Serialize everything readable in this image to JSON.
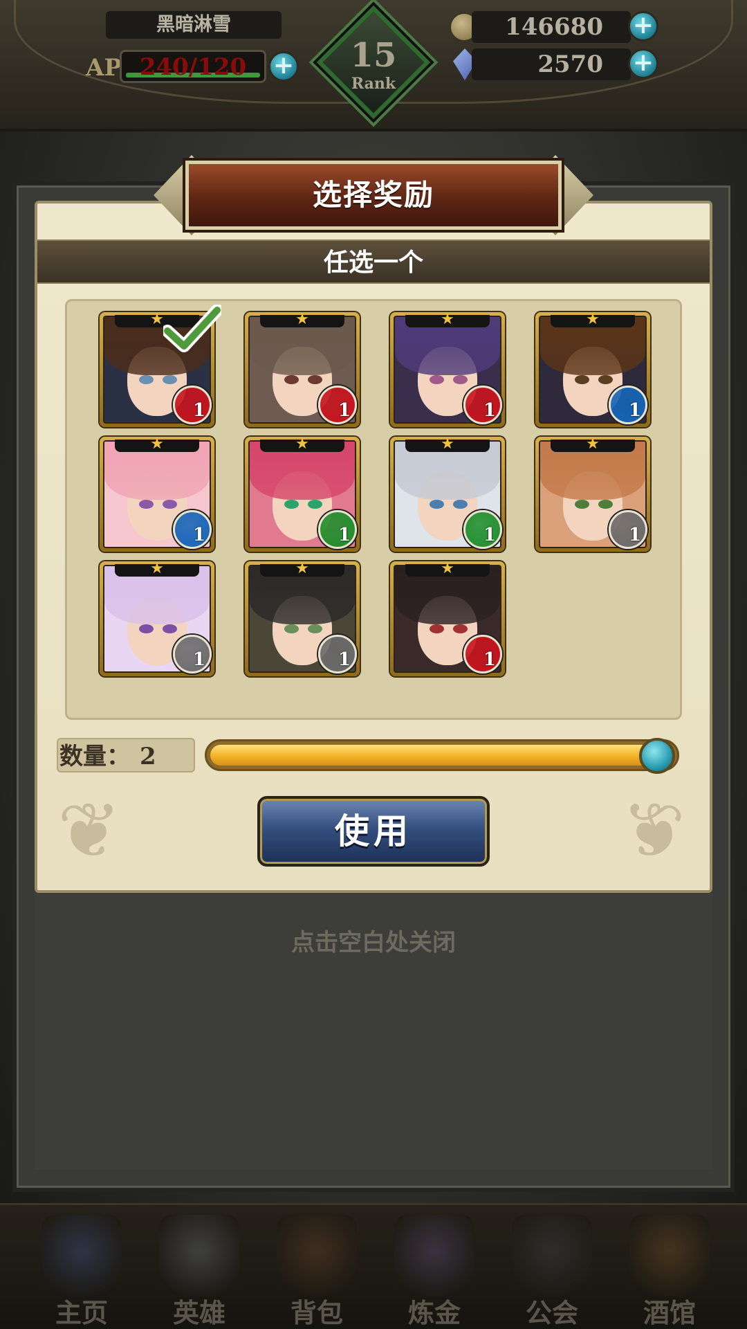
{
  "hud": {
    "player_name": "黑暗淋雪",
    "ap_label": "AP",
    "ap_value": "240/120",
    "ap_fill": 1.0,
    "rank_number": "15",
    "rank_label": "Rank",
    "gold": "146680",
    "crystals": "2570",
    "plus_symbol": "+"
  },
  "dialog": {
    "title": "选择奖励",
    "subtitle": "任选一个",
    "quantity_label": "数量：",
    "quantity_value": "2",
    "slider_fill": 1.0,
    "use_button": "使用",
    "close_hint": "点击空白处关闭"
  },
  "heroes": [
    {
      "name": "hero-1",
      "stars": "★",
      "level": "1",
      "class_color": "#c8141e",
      "class_icon": "sword-class-icon",
      "hair": "#4a2c1a",
      "bg": "#2b3145",
      "eye": "#6b8fb3",
      "selected": true
    },
    {
      "name": "hero-2",
      "stars": "★",
      "level": "1",
      "class_color": "#c8141e",
      "class_icon": "sword-class-icon",
      "hair": "#6b5a4c",
      "bg": "#6e5b52",
      "eye": "#6b3a33",
      "selected": false
    },
    {
      "name": "hero-3",
      "stars": "★",
      "level": "1",
      "class_color": "#c8141e",
      "class_icon": "scythe-class-icon",
      "hair": "#4f3b7a",
      "bg": "#3a2e4d",
      "eye": "#a3588a",
      "selected": false
    },
    {
      "name": "hero-4",
      "stars": "★",
      "level": "1",
      "class_color": "#1565b8",
      "class_icon": "spear-class-icon",
      "hair": "#5b3417",
      "bg": "#2e2a3c",
      "eye": "#5a4020",
      "selected": false
    },
    {
      "name": "hero-5",
      "stars": "★",
      "level": "1",
      "class_color": "#1565b8",
      "class_icon": "staff-class-icon",
      "hair": "#f0a4b4",
      "bg": "#f6c7cf",
      "eye": "#8a5aa8",
      "selected": false
    },
    {
      "name": "hero-6",
      "stars": "★",
      "level": "1",
      "class_color": "#1f8f2c",
      "class_icon": "leaf-class-icon",
      "hair": "#d6466a",
      "bg": "#e27a8f",
      "eye": "#2da36b",
      "selected": false
    },
    {
      "name": "hero-7",
      "stars": "★",
      "level": "1",
      "class_color": "#1f8f2c",
      "class_icon": "leaf-class-icon",
      "hair": "#c5cad4",
      "bg": "#dfe3ea",
      "eye": "#4a7fb0",
      "selected": false
    },
    {
      "name": "hero-8",
      "stars": "★",
      "level": "1",
      "class_color": "#6b6b6b",
      "class_icon": "bow-class-icon",
      "hair": "#c47a4a",
      "bg": "#d9a07a",
      "eye": "#4d7f3a",
      "selected": false
    },
    {
      "name": "hero-9",
      "stars": "★",
      "level": "1",
      "class_color": "#6b6b6b",
      "class_icon": "wand-class-icon",
      "hair": "#d9c1ea",
      "bg": "#e8d6f2",
      "eye": "#7c4ea8",
      "selected": false
    },
    {
      "name": "hero-10",
      "stars": "★",
      "level": "1",
      "class_color": "#6b6b6b",
      "class_icon": "wand-class-icon",
      "hair": "#2c2a28",
      "bg": "#4a4638",
      "eye": "#6a8f5a",
      "selected": false
    },
    {
      "name": "hero-11",
      "stars": "★",
      "level": "1",
      "class_color": "#c8141e",
      "class_icon": "scythe-class-icon",
      "hair": "#2b2020",
      "bg": "#3a2a2a",
      "eye": "#a13030",
      "selected": false
    }
  ],
  "nav": [
    {
      "label": "主页",
      "color": "#5a6ea8",
      "icon": "castle-icon"
    },
    {
      "label": "英雄",
      "color": "#8a8f98",
      "icon": "helmet-icon"
    },
    {
      "label": "背包",
      "color": "#8a5a3a",
      "icon": "bag-icon"
    },
    {
      "label": "炼金",
      "color": "#7a6a9a",
      "icon": "potion-icon"
    },
    {
      "label": "公会",
      "color": "#5c5c5c",
      "icon": "guild-shield-icon"
    },
    {
      "label": "酒馆",
      "color": "#9a6a3a",
      "icon": "tavern-mug-icon"
    }
  ]
}
